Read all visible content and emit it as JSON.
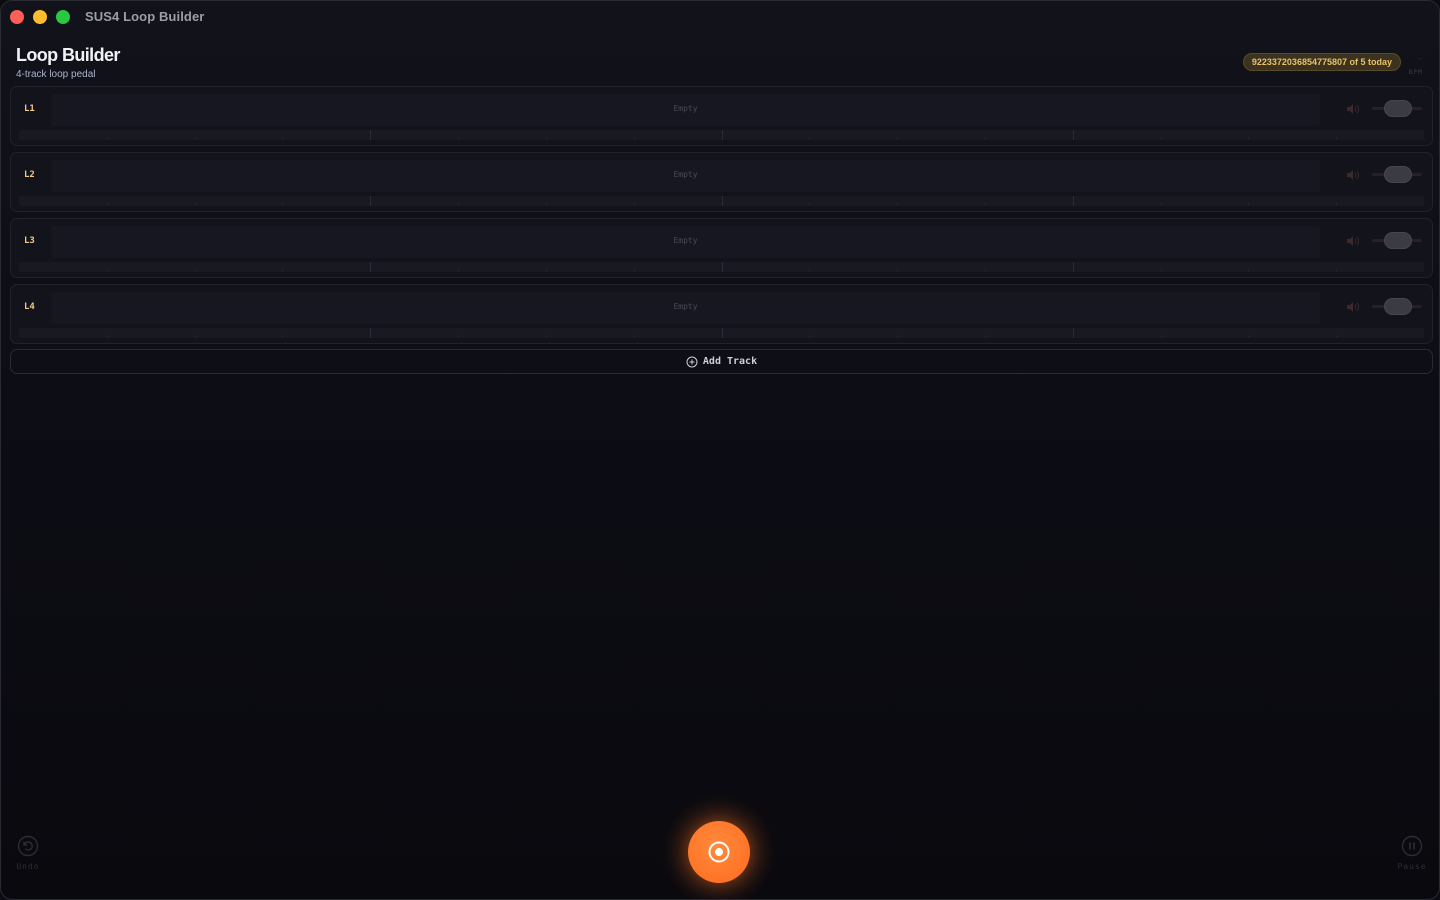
{
  "window": {
    "title": "SUS4 Loop Builder"
  },
  "header": {
    "title": "Loop Builder",
    "subtitle": "4-track loop pedal",
    "usage_badge": "9223372036854775807 of 5 today",
    "bpm_value": "—",
    "bpm_label": "BPM"
  },
  "tracks": [
    {
      "label": "L1",
      "status": "Empty"
    },
    {
      "label": "L2",
      "status": "Empty"
    },
    {
      "label": "L3",
      "status": "Empty"
    },
    {
      "label": "L4",
      "status": "Empty"
    }
  ],
  "add_track": {
    "label": "Add Track",
    "icon": "plus-circle-icon"
  },
  "controls": {
    "undo": {
      "label": "Undo",
      "icon": "undo-icon"
    },
    "pause": {
      "label": "Pause",
      "icon": "pause-icon"
    },
    "record": {
      "icon": "record-icon"
    }
  },
  "colors": {
    "accent": "#ff6a1c",
    "track_label": "#f0c987",
    "badge_text": "#e8c26a",
    "background": "#0b0b11"
  }
}
